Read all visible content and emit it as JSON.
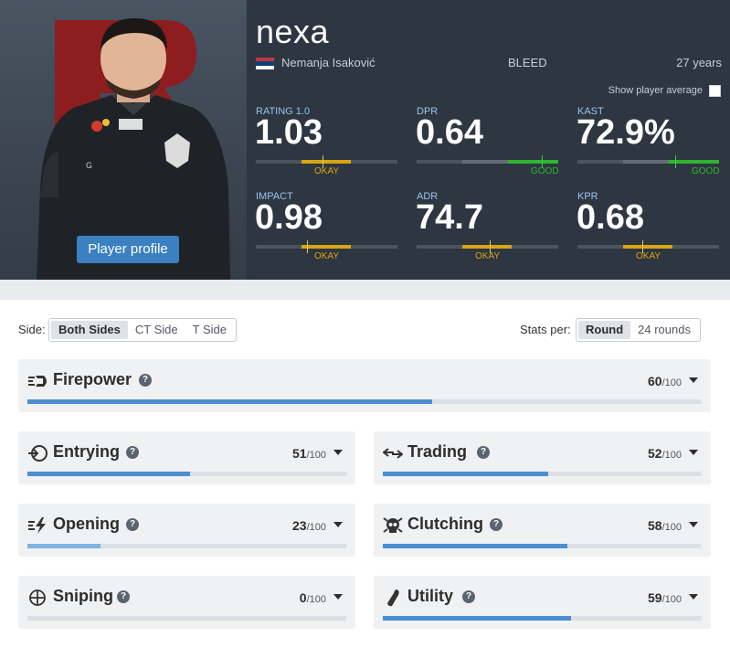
{
  "player": {
    "nickname": "nexa",
    "real_name": "Nemanja Isaković",
    "team": "BLEED",
    "age": "27 years",
    "flag_colors": [
      "#c6363c",
      "#0c4076",
      "#ffffff"
    ],
    "profile_button": "Player profile"
  },
  "show_average": {
    "label": "Show player average",
    "checked": false
  },
  "rating_colors": {
    "okay": "#d9a511",
    "good": "#2fb52f"
  },
  "stats": [
    {
      "label": "RATING 1.0",
      "value": "1.03",
      "tag": "OKAY",
      "grade": "okay"
    },
    {
      "label": "DPR",
      "value": "0.64",
      "tag": "GOOD",
      "grade": "good"
    },
    {
      "label": "KAST",
      "value": "72.9%",
      "tag": "GOOD",
      "grade": "good"
    },
    {
      "label": "IMPACT",
      "value": "0.98",
      "tag": "OKAY",
      "grade": "okay"
    },
    {
      "label": "ADR",
      "value": "74.7",
      "tag": "OKAY",
      "grade": "okay"
    },
    {
      "label": "KPR",
      "value": "0.68",
      "tag": "OKAY",
      "grade": "okay"
    }
  ],
  "filters": {
    "side_label": "Side:",
    "side_options": [
      "Both Sides",
      "CT Side",
      "T Side"
    ],
    "side_selected": "Both Sides",
    "stats_per_label": "Stats per:",
    "stats_per_options": [
      "Round",
      "24 rounds"
    ],
    "stats_per_selected": "Round"
  },
  "bar_colors": {
    "strong": "#4a8fd1",
    "weak": "#7fb3e0"
  },
  "categories": [
    {
      "key": "firepower",
      "name": "Firepower",
      "score": "60",
      "max": "/100",
      "icon": "firepower-icon"
    },
    {
      "key": "entrying",
      "name": "Entrying",
      "score": "51",
      "max": "/100",
      "icon": "entry-icon"
    },
    {
      "key": "trading",
      "name": "Trading",
      "score": "52",
      "max": "/100",
      "icon": "trading-icon"
    },
    {
      "key": "opening",
      "name": "Opening",
      "score": "23",
      "max": "/100",
      "icon": "opening-icon"
    },
    {
      "key": "clutching",
      "name": "Clutching",
      "score": "58",
      "max": "/100",
      "icon": "skull-icon"
    },
    {
      "key": "sniping",
      "name": "Sniping",
      "score": "0",
      "max": "/100",
      "icon": "crosshair-icon"
    },
    {
      "key": "utility",
      "name": "Utility",
      "score": "59",
      "max": "/100",
      "icon": "grenade-icon"
    }
  ]
}
